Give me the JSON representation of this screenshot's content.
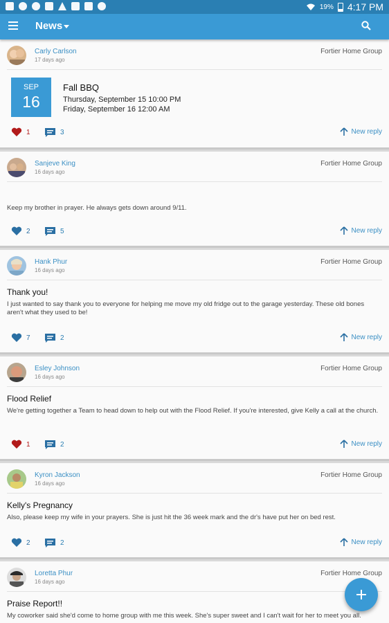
{
  "status_bar": {
    "battery": "19%",
    "time": "4:17 PM",
    "battery_level": 0.19,
    "icons": [
      "wrench-icon",
      "keyhole-icon",
      "keyhole-icon",
      "gmail-icon",
      "warning-icon",
      "dropbox-icon",
      "image-icon",
      "signal-icon",
      "wifi-icon",
      "battery-icon"
    ]
  },
  "app_bar": {
    "title": "News",
    "menu_icon": "menu-icon",
    "dropdown_icon": "caret-down-icon",
    "search_icon": "search-icon"
  },
  "colors": {
    "primary": "#3a9ad5",
    "status_bar": "#2a7fb3",
    "link": "#3a8fc4",
    "heart_liked": "#b21b1b",
    "heart_default": "#2a6fa3"
  },
  "reply_label": "New reply",
  "posts": [
    {
      "author": "Carly Carlson",
      "age": "17 days ago",
      "group": "Fortier Home Group",
      "event": {
        "month": "SEP",
        "day": "16",
        "title": "Fall BBQ",
        "line1": "Thursday, September 15   10:00 PM",
        "line2": "Friday, September 16   12:00 AM"
      },
      "likes": "1",
      "liked": true,
      "comments": "3"
    },
    {
      "author": "Sanjeve King",
      "age": "16 days ago",
      "group": "Fortier Home Group",
      "title": "",
      "body": "Keep my brother in prayer. He always gets down around 9/11.",
      "likes": "2",
      "liked": false,
      "comments": "5"
    },
    {
      "author": "Hank Phur",
      "age": "16 days ago",
      "group": "Fortier Home Group",
      "title": "Thank you!",
      "body": "I just wanted to say thank you to everyone for helping me move my old fridge out to the garage yesterday. These old bones aren't what they used to be!",
      "likes": "7",
      "liked": false,
      "comments": "2"
    },
    {
      "author": "Esley Johnson",
      "age": "16 days ago",
      "group": "Fortier Home Group",
      "title": "Flood Relief",
      "body": "We're getting together a Team to head down to help out with the Flood Relief. If you're interested, give Kelly a call at the church.",
      "likes": "1",
      "liked": true,
      "comments": "2"
    },
    {
      "author": "Kyron Jackson",
      "age": "16 days ago",
      "group": "Fortier Home Group",
      "title": "Kelly's Pregnancy",
      "body": "Also, please keep my wife in your prayers. She is just hit the 36 week mark and the dr's have put her on bed rest.",
      "likes": "2",
      "liked": false,
      "comments": "2"
    },
    {
      "author": "Loretta Phur",
      "age": "16 days ago",
      "group": "Fortier Home Group",
      "title": "Praise Report!!",
      "body": "My coworker said she'd come to home group with me this week. She's super sweet and I can't wait for her to meet you all."
    }
  ],
  "fab": {
    "icon": "plus-icon"
  }
}
